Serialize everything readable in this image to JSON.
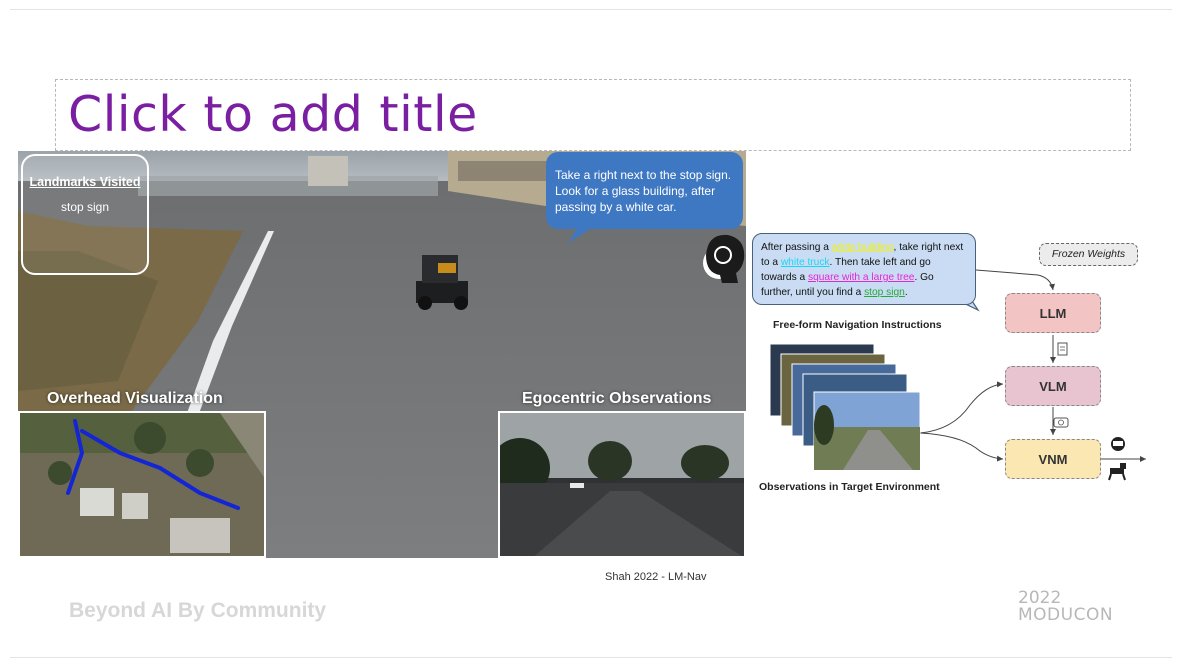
{
  "slide": {
    "title": "Click to add title",
    "caption": "Shah 2022 - LM-Nav",
    "footer": "Beyond AI By Community",
    "logo": {
      "year": "2022",
      "name": "MODUCON"
    }
  },
  "video": {
    "landmarks_title": "Landmarks Visited",
    "landmarks_item": "stop sign",
    "instruction": "Take a right next to the stop sign. Look for a glass building, after passing by a white car.",
    "overhead_label": "Overhead Visualization",
    "egocentric_label": "Egocentric Observations"
  },
  "diagram": {
    "instruction_parts": [
      "After passing a ",
      "white building",
      ", take right next to a ",
      "white truck",
      ". Then take left and go towards a ",
      "square with a large tree",
      ". Go further, until you find a ",
      "stop sign",
      "."
    ],
    "instructions_label": "Free-form Navigation Instructions",
    "observations_label": "Observations in Target Environment",
    "frozen_label": "Frozen Weights",
    "llm_label": "LLM",
    "vlm_label": "VLM",
    "vnm_label": "VNM",
    "colors": {
      "llm": "#f2c4c4",
      "vlm": "#e7c4cf",
      "vnm": "#fae7b1",
      "highlight_yellow": "#f3f10e",
      "highlight_cyan": "#18d7f4",
      "highlight_magenta": "#e327d3",
      "highlight_green": "#27a83a"
    }
  }
}
